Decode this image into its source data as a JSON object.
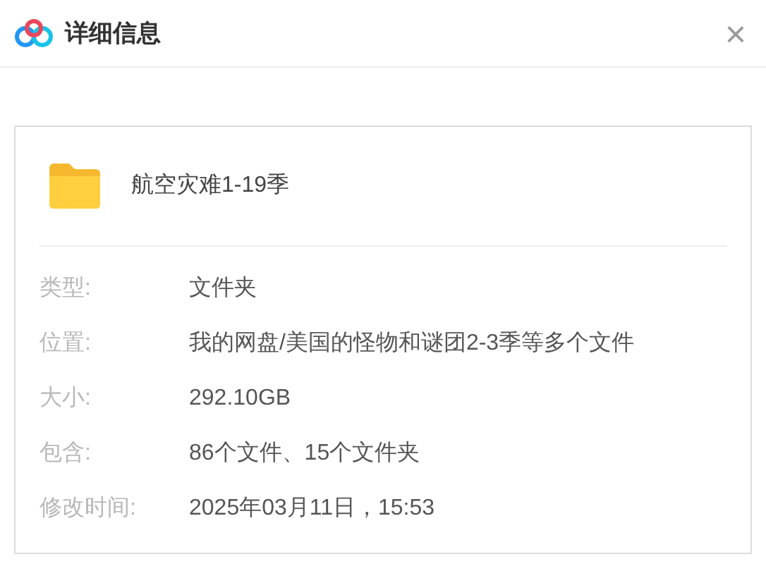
{
  "window": {
    "title": "详细信息",
    "close": "×"
  },
  "item": {
    "name": "航空灾难1-19季"
  },
  "details": [
    {
      "label": "类型:",
      "value": "文件夹"
    },
    {
      "label": "位置:",
      "value": "我的网盘/美国的怪物和谜团2-3季等多个文件"
    },
    {
      "label": "大小:",
      "value": "292.10GB"
    },
    {
      "label": "包含:",
      "value": "86个文件、15个文件夹"
    },
    {
      "label": "修改时间:",
      "value": "2025年03月11日，15:53"
    }
  ]
}
